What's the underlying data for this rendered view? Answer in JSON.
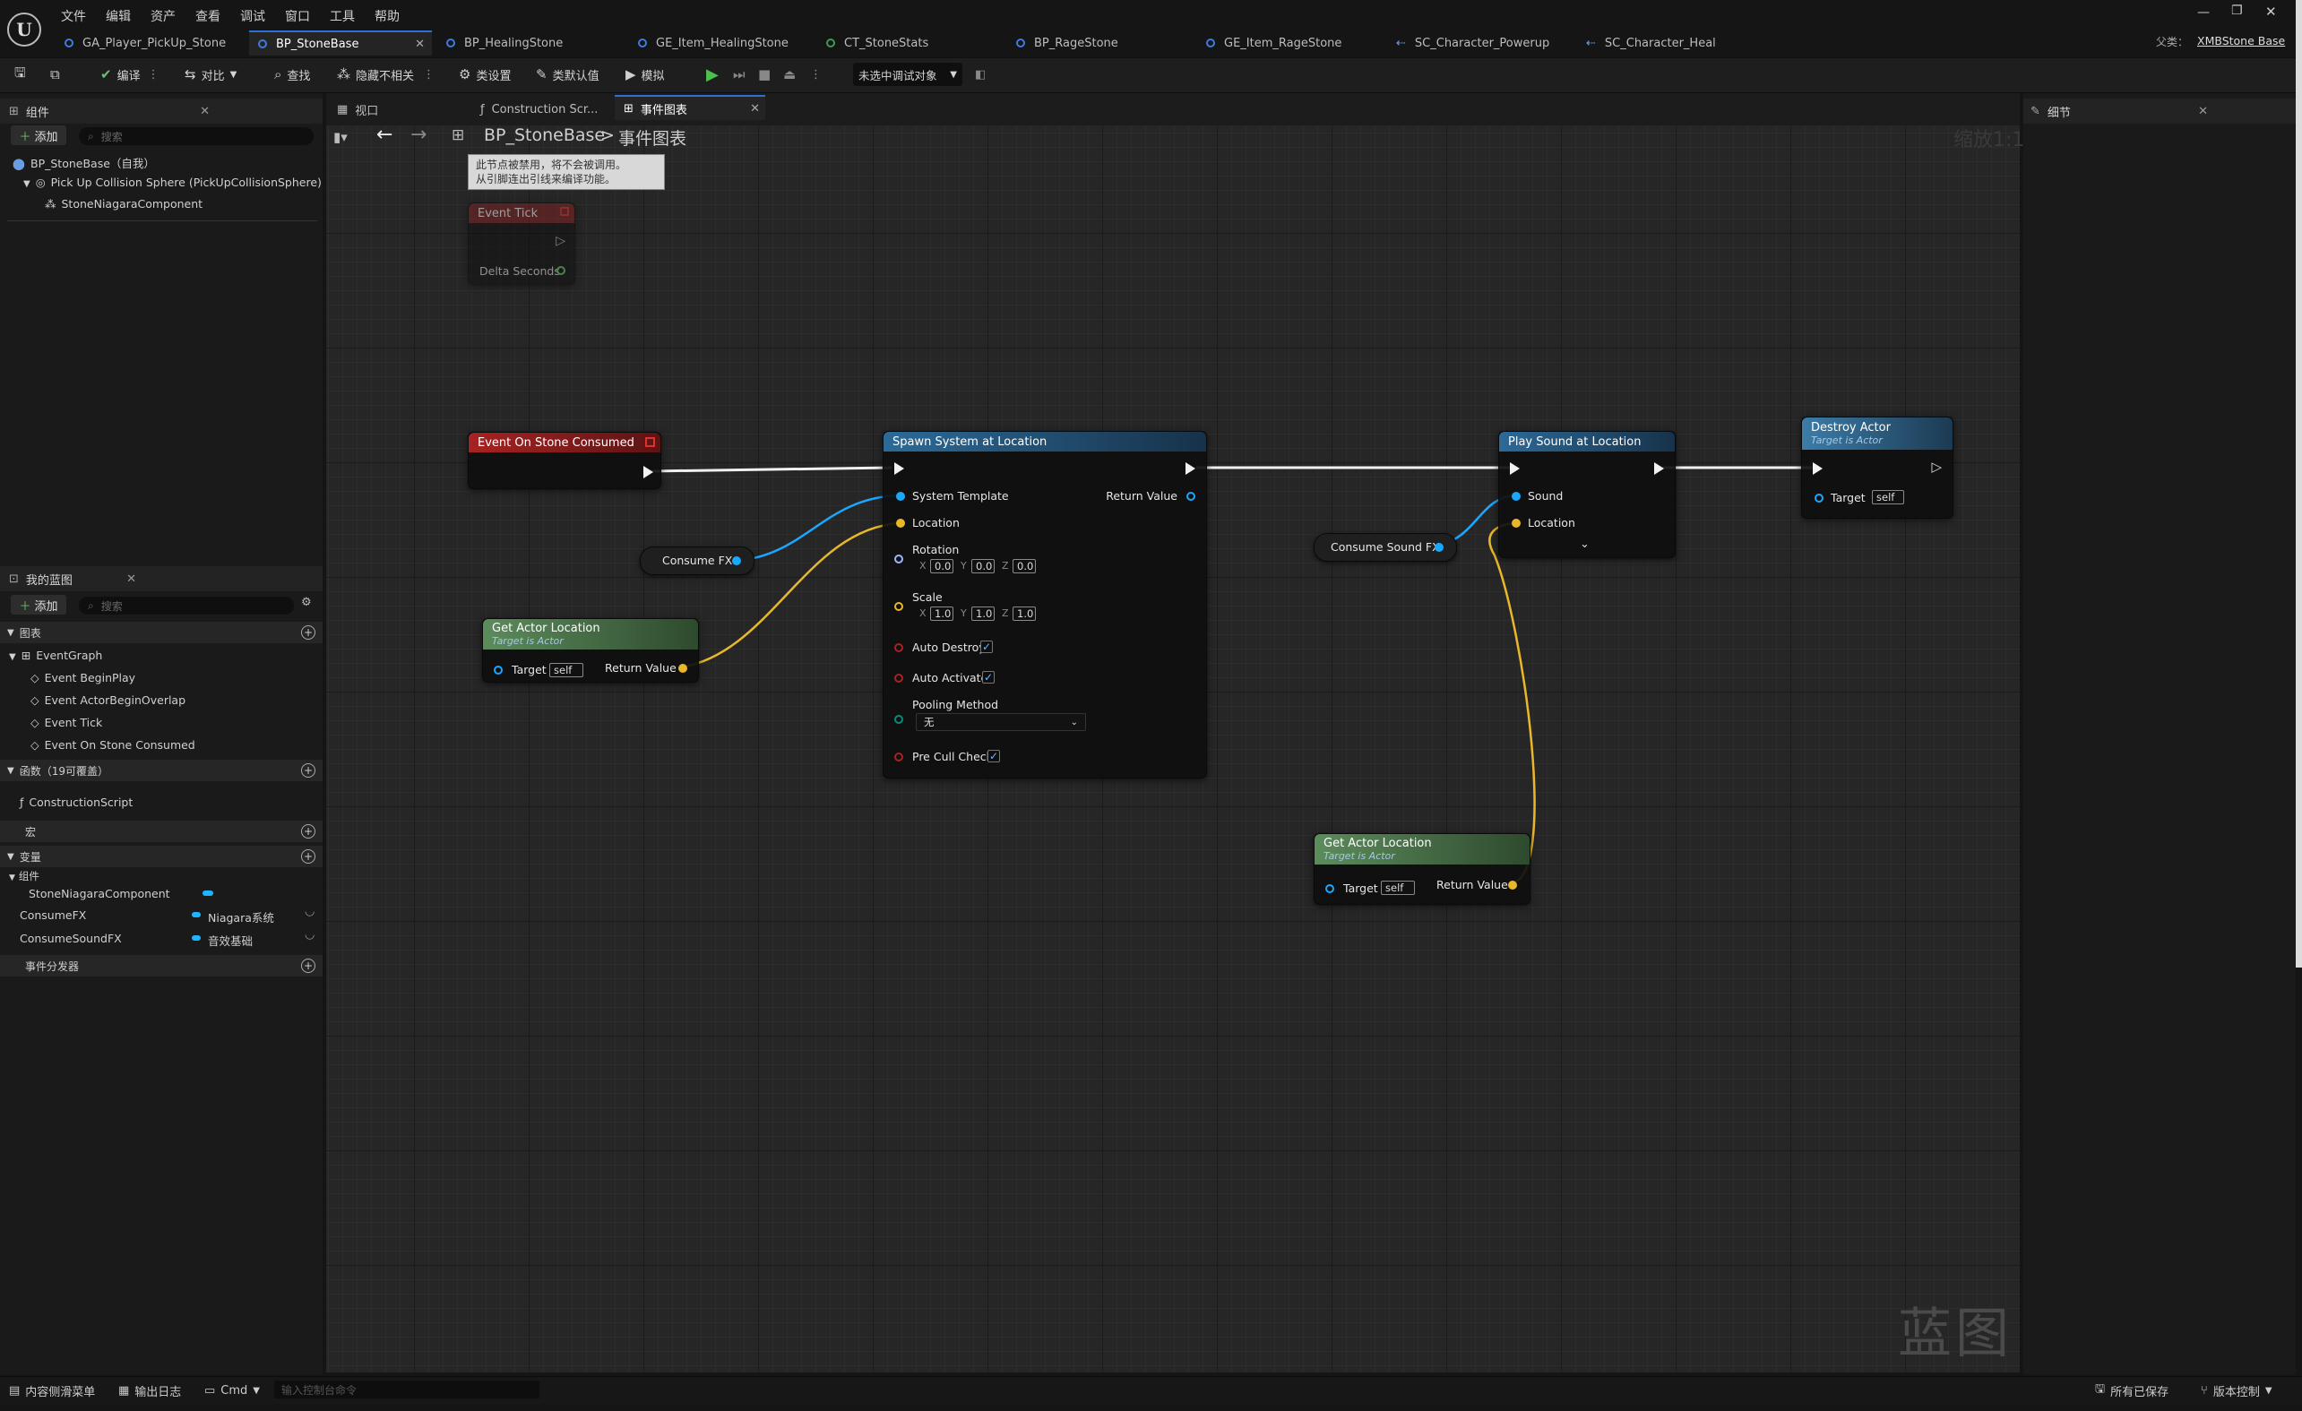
{
  "menu": [
    "文件",
    "编辑",
    "资产",
    "查看",
    "调试",
    "窗口",
    "工具",
    "帮助"
  ],
  "tabs": [
    {
      "label": "GA_Player_PickUp_Stone",
      "icon": "blueprint-icon"
    },
    {
      "label": "BP_StoneBase",
      "icon": "blueprint-icon",
      "active": true
    },
    {
      "label": "BP_HealingStone",
      "icon": "blueprint-icon"
    },
    {
      "label": "GE_Item_HealingStone",
      "icon": "blueprint-icon"
    },
    {
      "label": "CT_StoneStats",
      "icon": "curve-table-icon"
    },
    {
      "label": "BP_RageStone",
      "icon": "blueprint-icon"
    },
    {
      "label": "GE_Item_RageStone",
      "icon": "blueprint-icon"
    },
    {
      "label": "SC_Character_Powerup",
      "icon": "script-icon"
    },
    {
      "label": "SC_Character_Heal",
      "icon": "script-icon"
    }
  ],
  "title_right": {
    "parent_label": "父类：",
    "parent_value": "XMBStone Base"
  },
  "toolbar": {
    "compile": "编译",
    "diff": "对比",
    "find": "查找",
    "hide_unrelated": "隐藏不相关",
    "class_settings": "类设置",
    "class_defaults": "类默认值",
    "simulate": "模拟",
    "debug_target": "未选中调试对象"
  },
  "components": {
    "title": "组件",
    "add": "添加",
    "search_placeholder": "搜索",
    "items": [
      "BP_StoneBase（自我）",
      "Pick Up Collision Sphere (PickUpCollisionSphere)",
      "StoneNiagaraComponent"
    ]
  },
  "my_blueprint": {
    "title": "我的蓝图",
    "add": "添加",
    "search_placeholder": "搜索",
    "graphs_label": "图表",
    "event_graph": "EventGraph",
    "events": [
      "Event BeginPlay",
      "Event ActorBeginOverlap",
      "Event Tick",
      "Event On Stone Consumed"
    ],
    "functions_label": "函数（19可覆盖）",
    "construction_script": "ConstructionScript",
    "macros_label": "宏",
    "variables_label": "变量",
    "components_label": "组件",
    "variables": [
      {
        "name": "StoneNiagaraComponent",
        "type": ""
      },
      {
        "name": "ConsumeFX",
        "type": "Niagara系统"
      },
      {
        "name": "ConsumeSoundFX",
        "type": "音效基础"
      }
    ],
    "dispatchers_label": "事件分发器"
  },
  "graph_tabs": [
    "视口",
    "Construction Scr...",
    "事件图表"
  ],
  "breadcrumb": {
    "root": "BP_StoneBase",
    "sep": ">",
    "current": "事件图表"
  },
  "zoom": "缩放1:1",
  "watermark": "蓝图",
  "details": {
    "title": "细节"
  },
  "nodes": {
    "disabled_note": "此节点被禁用，将不会被调用。\n从引脚连出引线来编译功能。",
    "event_tick": {
      "title": "Event Tick",
      "pin": "Delta Seconds"
    },
    "event_consumed": {
      "title": "Event On Stone Consumed"
    },
    "spawn": {
      "title": "Spawn System at Location",
      "system_template": "System Template",
      "location": "Location",
      "rotation": "Rotation",
      "scale": "Scale",
      "auto_destroy": "Auto Destroy",
      "auto_activate": "Auto Activate",
      "pooling": "Pooling Method",
      "pooling_value": "无",
      "pre_cull": "Pre Cull Check",
      "return": "Return Value",
      "rot": [
        "0.0",
        "0.0",
        "0.0"
      ],
      "scl": [
        "1.0",
        "1.0",
        "1.0"
      ],
      "axes": [
        "X",
        "Y",
        "Z"
      ]
    },
    "play_sound": {
      "title": "Play Sound at Location",
      "sound": "Sound",
      "location": "Location"
    },
    "destroy": {
      "title": "Destroy Actor",
      "sub": "Target is Actor",
      "target": "Target",
      "self": "self"
    },
    "get_loc1": {
      "title": "Get Actor Location",
      "sub": "Target is Actor",
      "target": "Target",
      "self": "self",
      "ret": "Return Value"
    },
    "get_loc2": {
      "title": "Get Actor Location",
      "sub": "Target is Actor",
      "target": "Target",
      "self": "self",
      "ret": "Return Value"
    },
    "consume_fx": "Consume FX",
    "consume_sound": "Consume Sound FX"
  },
  "statusbar": {
    "content_drawer": "内容侧滑菜单",
    "output_log": "输出日志",
    "cmd": "Cmd",
    "cmd_placeholder": "输入控制台命令",
    "saved": "所有已保存",
    "source_control": "版本控制"
  }
}
